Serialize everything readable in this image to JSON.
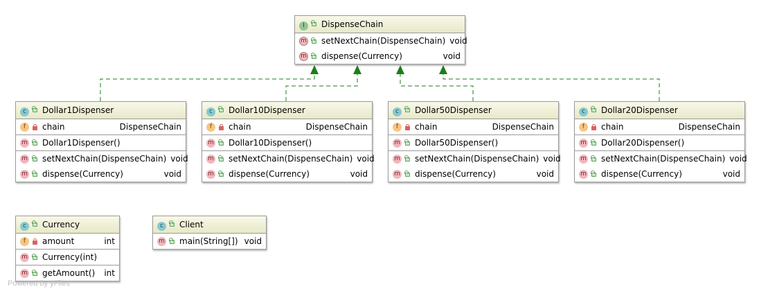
{
  "classes": {
    "dispense_chain": {
      "kind": "I",
      "name": "DispenseChain",
      "methods": [
        {
          "name": "setNextChain(DispenseChain)",
          "type": "void"
        },
        {
          "name": "dispense(Currency)",
          "type": "void"
        }
      ]
    },
    "dollar1": {
      "kind": "c",
      "name": "Dollar1Dispenser",
      "field": {
        "name": "chain",
        "type": "DispenseChain"
      },
      "constructor": "Dollar1Dispenser()",
      "methods": [
        {
          "name": "setNextChain(DispenseChain)",
          "type": "void"
        },
        {
          "name": "dispense(Currency)",
          "type": "void"
        }
      ]
    },
    "dollar10": {
      "kind": "c",
      "name": "Dollar10Dispenser",
      "field": {
        "name": "chain",
        "type": "DispenseChain"
      },
      "constructor": "Dollar10Dispenser()",
      "methods": [
        {
          "name": "setNextChain(DispenseChain)",
          "type": "void"
        },
        {
          "name": "dispense(Currency)",
          "type": "void"
        }
      ]
    },
    "dollar50": {
      "kind": "c",
      "name": "Dollar50Dispenser",
      "field": {
        "name": "chain",
        "type": "DispenseChain"
      },
      "constructor": "Dollar50Dispenser()",
      "methods": [
        {
          "name": "setNextChain(DispenseChain)",
          "type": "void"
        },
        {
          "name": "dispense(Currency)",
          "type": "void"
        }
      ]
    },
    "dollar20": {
      "kind": "c",
      "name": "Dollar20Dispenser",
      "field": {
        "name": "chain",
        "type": "DispenseChain"
      },
      "constructor": "Dollar20Dispenser()",
      "methods": [
        {
          "name": "setNextChain(DispenseChain)",
          "type": "void"
        },
        {
          "name": "dispense(Currency)",
          "type": "void"
        }
      ]
    },
    "currency": {
      "kind": "c",
      "name": "Currency",
      "field": {
        "name": "amount",
        "type": "int"
      },
      "constructor": "Currency(int)",
      "methods": [
        {
          "name": "getAmount()",
          "type": "int"
        }
      ]
    },
    "client": {
      "kind": "c",
      "name": "Client",
      "methods": [
        {
          "name": "main(String[])",
          "type": "void"
        }
      ]
    }
  },
  "icon_letters": {
    "class": "c",
    "interface": "I",
    "method": "m",
    "field": "f"
  },
  "colors": {
    "header_top": "#f8f8ea",
    "header_bottom": "#e8e8c8",
    "border": "#9a9a9a",
    "realization_line": "#1a7f1a",
    "class_icon": "#88c9cf",
    "interface_icon": "#93c593",
    "method_icon": "#f0b7bd",
    "field_icon": "#f5c682"
  },
  "watermark": "Powered by yFiles"
}
